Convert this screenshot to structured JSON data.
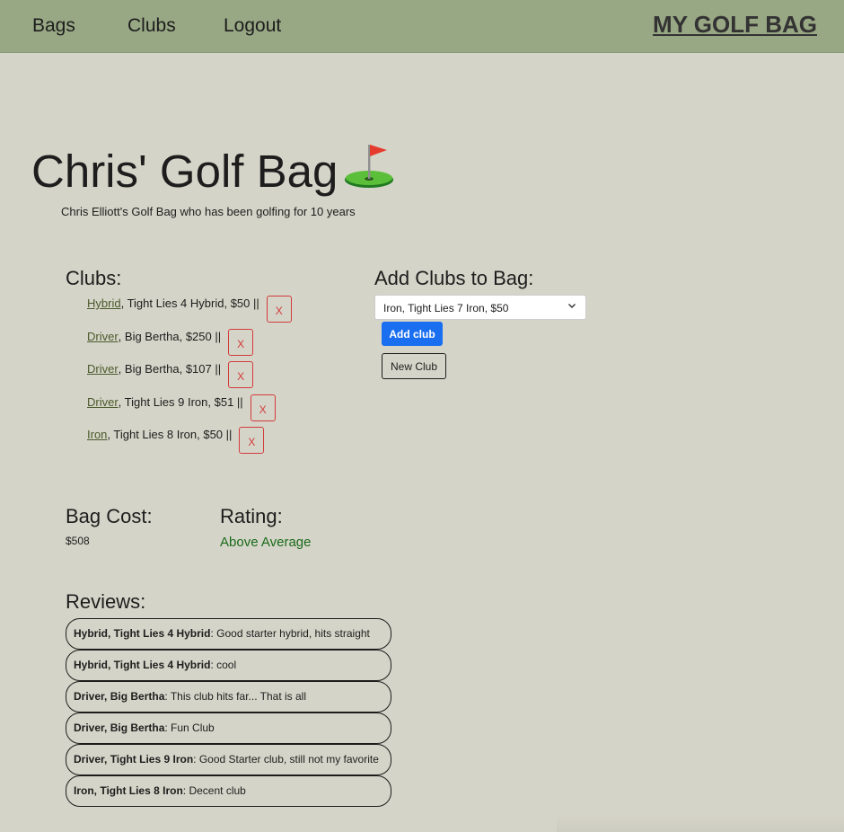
{
  "nav": {
    "links": [
      "Bags",
      "Clubs",
      "Logout"
    ],
    "brand": "MY GOLF BAG"
  },
  "page": {
    "title": "Chris' Golf Bag",
    "title_icon": "golf-flag-icon",
    "subtitle": "Chris Elliott's Golf Bag who has been golfing for 10 years"
  },
  "clubs": {
    "heading": "Clubs:",
    "remove_label": "X",
    "items": [
      {
        "type": "Hybrid",
        "details": ", Tight Lies 4 Hybrid, $50 ||"
      },
      {
        "type": "Driver",
        "details": ", Big Bertha, $250 ||"
      },
      {
        "type": "Driver",
        "details": ", Big Bertha, $107 ||"
      },
      {
        "type": "Driver",
        "details": ", Tight Lies 9 Iron, $51 ||"
      },
      {
        "type": "Iron",
        "details": ", Tight Lies 8 Iron, $50 ||"
      }
    ]
  },
  "add_clubs": {
    "heading": "Add Clubs to Bag:",
    "selected": "Iron, Tight Lies 7 Iron, $50",
    "add_button": "Add club",
    "new_button": "New Club"
  },
  "cost": {
    "heading": "Bag Cost:",
    "value": "$508"
  },
  "rating": {
    "heading": "Rating:",
    "value": "Above Average",
    "color": "#1a6b1a"
  },
  "reviews": {
    "heading": "Reviews:",
    "items": [
      {
        "club": "Hybrid, Tight Lies 4 Hybrid",
        "text": ": Good starter hybrid, hits straight"
      },
      {
        "club": "Hybrid, Tight Lies 4 Hybrid",
        "text": ": cool"
      },
      {
        "club": "Driver, Big Bertha",
        "text": ": This club hits far... That is all"
      },
      {
        "club": "Driver, Big Bertha",
        "text": ": Fun Club"
      },
      {
        "club": "Driver, Tight Lies 9 Iron",
        "text": ": Good Starter club, still not my favorite"
      },
      {
        "club": "Iron, Tight Lies 8 Iron",
        "text": ": Decent club"
      }
    ]
  },
  "colors": {
    "navbar": "#98a784",
    "background": "#d5d4c8",
    "primary_button": "#1a6ef0",
    "remove_button": "#d23b3b",
    "link": "#4a5a2c"
  }
}
